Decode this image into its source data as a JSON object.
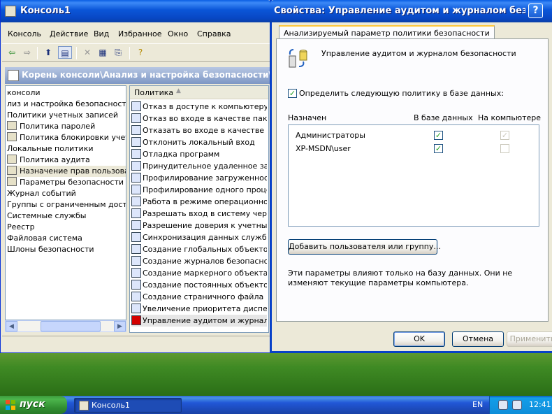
{
  "console_window": {
    "title": "Консоль1",
    "menu": [
      "Консоль",
      "Действие",
      "Вид",
      "Избранное",
      "Окно",
      "Справка"
    ],
    "toolbar_icons": [
      "back-icon",
      "forward-icon",
      "up-folder-icon",
      "show-tree-icon",
      "delete-icon",
      "properties-icon",
      "export-icon",
      "help-icon"
    ],
    "path": "Корень консоли\\Анализ и настройка безопасности\\Лока",
    "tree": [
      {
        "label": "консоли",
        "icon": false
      },
      {
        "label": "лиз и настройка безопасности",
        "icon": false
      },
      {
        "label": "Политики учетных записей",
        "icon": false
      },
      {
        "label": "Политика паролей",
        "icon": true
      },
      {
        "label": "Политика блокировки учетнс",
        "icon": true
      },
      {
        "label": "Локальные политики",
        "icon": false
      },
      {
        "label": "Политика аудита",
        "icon": true
      },
      {
        "label": "Назначение прав пользовате",
        "icon": true,
        "selected": true
      },
      {
        "label": "Параметры безопасности",
        "icon": true
      },
      {
        "label": "Журнал событий",
        "icon": false
      },
      {
        "label": "Группы с ограниченным доступо",
        "icon": false
      },
      {
        "label": "Системные службы",
        "icon": false
      },
      {
        "label": "Реестр",
        "icon": false
      },
      {
        "label": "Файловая система",
        "icon": false
      },
      {
        "label": "Шлоны безопасности",
        "icon": false
      }
    ],
    "list_header": "Политика",
    "policies": [
      "Отказ в доступе к компьютеру ...",
      "Отказ во входе в качестве паке...",
      "Отказать во входе в качестве с...",
      "Отклонить локальный вход",
      "Отладка программ",
      "Принудительное удаленное зав...",
      "Профилирование загруженност...",
      "Профилирование одного процесса",
      "Работа в режиме операционной ...",
      "Разрешать вход в систему чере...",
      "Разрешение доверия к учетным ...",
      "Синхронизация данных службы ...",
      "Создание глобальных объектов",
      "Создание журналов безопасности",
      "Создание маркерного объекта",
      "Создание постоянных объектов...",
      "Создание страничного файла",
      "Увеличение приоритета диспет...",
      "Управление аудитом и журнало..."
    ],
    "selected_policy_index": 18
  },
  "dialog": {
    "title": "Свойства: Управление аудитом и журналом безопасн",
    "help_label": "?",
    "tab_label": "Анализируемый параметр политики безопасности",
    "policy_name": "Управление аудитом и журналом безопасности",
    "define_label": "Определить следующую политику в базе данных:",
    "define_checked": true,
    "columns": [
      "Назначен",
      "В базе данных",
      "На компьютере"
    ],
    "rows": [
      {
        "name": "Администраторы",
        "in_db": true,
        "on_computer": true
      },
      {
        "name": "XP-MSDN\\user",
        "in_db": true,
        "on_computer": false
      }
    ],
    "add_button": "Добавить пользователя или группу...",
    "note": "Эти параметры влияют только на базу данных. Они не изменяют текущие параметры компьютера.",
    "ok": "OK",
    "cancel": "Отмена",
    "apply": "Применить"
  },
  "taskbar": {
    "start": "пуск",
    "task": "Консоль1",
    "lang": "EN",
    "clock": "12:41"
  },
  "colors": {
    "titlebar": "#0b56d8",
    "window_bg": "#ece9d8",
    "start_green": "#3c9a3c",
    "check_green": "#21a121"
  }
}
